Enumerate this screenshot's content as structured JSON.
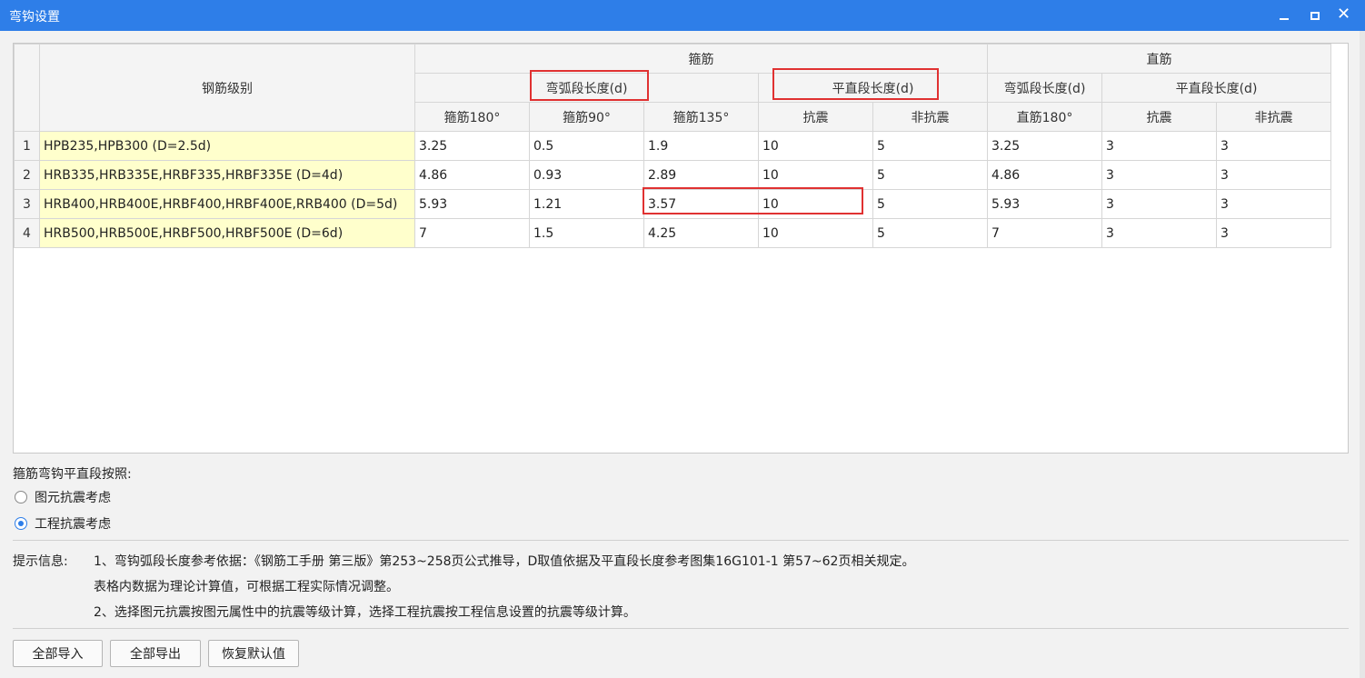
{
  "window": {
    "title": "弯钩设置"
  },
  "headers": {
    "grade": "钢筋级别",
    "stirrup": "箍筋",
    "straight": "直筋",
    "arc_length": "弯弧段长度(d)",
    "flat_length": "平直段长度(d)",
    "arc_length2": "弯弧段长度(d)",
    "flat_length2": "平直段长度(d)",
    "cols": [
      "箍筋180°",
      "箍筋90°",
      "箍筋135°",
      "抗震",
      "非抗震",
      "直筋180°",
      "抗震",
      "非抗震"
    ]
  },
  "rows": [
    {
      "num": "1",
      "grade": "HPB235,HPB300 (D=2.5d)",
      "values": [
        "3.25",
        "0.5",
        "1.9",
        "10",
        "5",
        "3.25",
        "3",
        "3"
      ]
    },
    {
      "num": "2",
      "grade": "HRB335,HRB335E,HRBF335,HRBF335E (D=4d)",
      "values": [
        "4.86",
        "0.93",
        "2.89",
        "10",
        "5",
        "4.86",
        "3",
        "3"
      ]
    },
    {
      "num": "3",
      "grade": "HRB400,HRB400E,HRBF400,HRBF400E,RRB400 (D=5d)",
      "values": [
        "5.93",
        "1.21",
        "3.57",
        "10",
        "5",
        "5.93",
        "3",
        "3"
      ]
    },
    {
      "num": "4",
      "grade": "HRB500,HRB500E,HRBF500,HRBF500E (D=6d)",
      "values": [
        "7",
        "1.5",
        "4.25",
        "10",
        "5",
        "7",
        "3",
        "3"
      ]
    }
  ],
  "options": {
    "label": "箍筋弯钩平直段按照:",
    "items": [
      {
        "label": "图元抗震考虑",
        "checked": false
      },
      {
        "label": "工程抗震考虑",
        "checked": true
      }
    ]
  },
  "tips": {
    "label": "提示信息:",
    "lines": [
      "1、弯钩弧段长度参考依据：《钢筋工手册 第三版》第253~258页公式推导，D取值依据及平直段长度参考图集16G101-1 第57~62页相关规定。",
      "表格内数据为理论计算值，可根据工程实际情况调整。",
      "2、选择图元抗震按图元属性中的抗震等级计算，选择工程抗震按工程信息设置的抗震等级计算。"
    ]
  },
  "buttons": {
    "import": "全部导入",
    "export": "全部导出",
    "restore": "恢复默认值"
  },
  "colors": {
    "titlebar": "#2e7ee8",
    "grade_cell": "#ffffcc",
    "highlight": "#e03131"
  }
}
